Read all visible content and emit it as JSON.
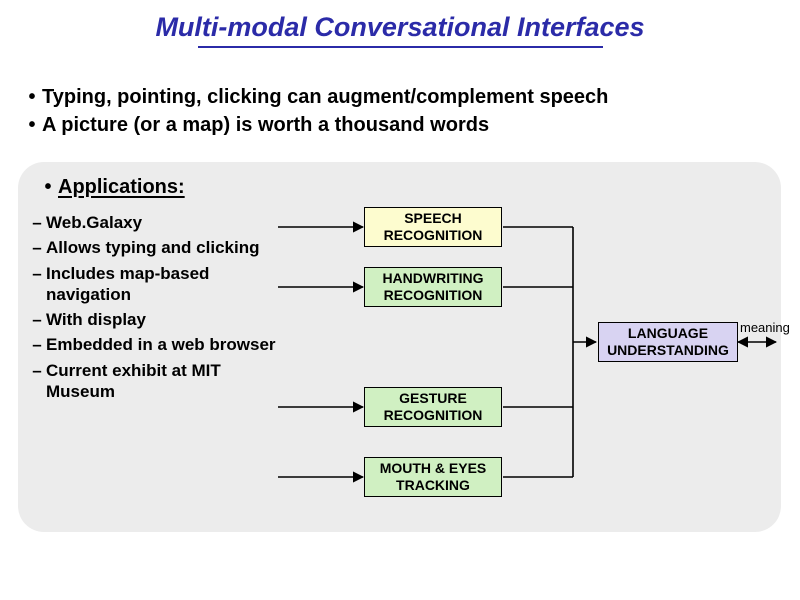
{
  "title": "Multi-modal Conversational Interfaces",
  "top_bullets": [
    "Typing, pointing, clicking can augment/complement speech",
    "A picture (or a map) is worth a thousand words"
  ],
  "applications_label": "Applications:",
  "sub_items": [
    "Web.Galaxy",
    "Allows typing and clicking",
    "Includes map-based navigation",
    "With display",
    "Embedded in a web browser",
    "Current exhibit at MIT Museum"
  ],
  "diagram": {
    "speech": "SPEECH\nRECOGNITION",
    "handwriting": "HANDWRITING\nRECOGNITION",
    "gesture": "GESTURE\nRECOGNITION",
    "tracking": "MOUTH & EYES\nTRACKING",
    "language": "LANGUAGE\nUNDERSTANDING",
    "meaning": "meaning"
  }
}
